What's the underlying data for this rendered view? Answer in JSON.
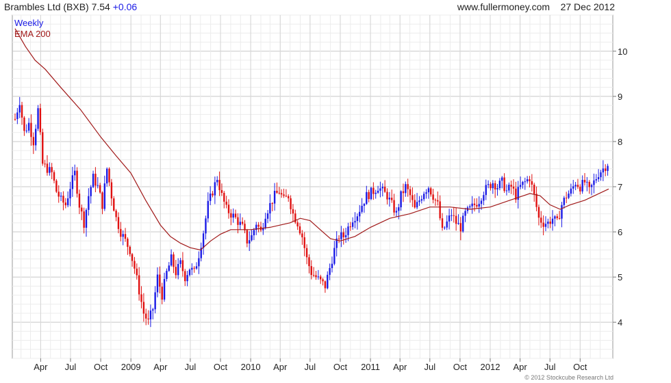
{
  "header": {
    "symbol_text": "Brambles Ltd (BXB) 7.54",
    "change": "+0.06",
    "source": "www.fullermoney.com",
    "date": "27 Dec 2012"
  },
  "copyright": "© 2012 Stockcube Research Ltd",
  "colors": {
    "up": "#1a1ae6",
    "down": "#e01010",
    "ema": "#a01818",
    "grid": "#cfcfcf"
  },
  "chart_data": {
    "type": "candlestick",
    "frequency": "Weekly",
    "legend": [
      {
        "name": "Weekly",
        "color": "#1a1ae6"
      },
      {
        "name": "EMA 200",
        "color": "#a01818"
      }
    ],
    "ylim": [
      3.2,
      10.8
    ],
    "y_ticks": [
      4,
      5,
      6,
      7,
      8,
      9,
      10
    ],
    "x_range": [
      "2008-01-14",
      "2012-12-27"
    ],
    "x_ticks": [
      {
        "label": "Apr",
        "date": "2008-04-01"
      },
      {
        "label": "Jul",
        "date": "2008-07-01"
      },
      {
        "label": "Oct",
        "date": "2008-10-01"
      },
      {
        "label": "2009",
        "date": "2009-01-01"
      },
      {
        "label": "Apr",
        "date": "2009-04-01"
      },
      {
        "label": "Jul",
        "date": "2009-07-01"
      },
      {
        "label": "Oct",
        "date": "2009-10-01"
      },
      {
        "label": "2010",
        "date": "2010-01-01"
      },
      {
        "label": "Apr",
        "date": "2010-04-01"
      },
      {
        "label": "Jul",
        "date": "2010-07-01"
      },
      {
        "label": "Oct",
        "date": "2010-10-01"
      },
      {
        "label": "2011",
        "date": "2011-01-01"
      },
      {
        "label": "Apr",
        "date": "2011-04-01"
      },
      {
        "label": "Jul",
        "date": "2011-07-01"
      },
      {
        "label": "Oct",
        "date": "2011-10-01"
      },
      {
        "label": "2012",
        "date": "2012-01-01"
      },
      {
        "label": "Apr",
        "date": "2012-04-01"
      },
      {
        "label": "Jul",
        "date": "2012-07-01"
      },
      {
        "label": "Oct",
        "date": "2012-10-01"
      }
    ],
    "close_path": [
      [
        "2008-01-14",
        8.5
      ],
      [
        "2008-01-28",
        8.9
      ],
      [
        "2008-02-11",
        8.2
      ],
      [
        "2008-02-25",
        8.4
      ],
      [
        "2008-03-10",
        8.0
      ],
      [
        "2008-03-24",
        8.7
      ],
      [
        "2008-04-07",
        7.5
      ],
      [
        "2008-04-21",
        7.4
      ],
      [
        "2008-05-05",
        7.3
      ],
      [
        "2008-05-19",
        6.9
      ],
      [
        "2008-06-02",
        6.7
      ],
      [
        "2008-06-16",
        6.6
      ],
      [
        "2008-06-30",
        7.0
      ],
      [
        "2008-07-14",
        7.3
      ],
      [
        "2008-07-28",
        6.6
      ],
      [
        "2008-08-11",
        6.2
      ],
      [
        "2008-08-25",
        6.8
      ],
      [
        "2008-09-08",
        7.2
      ],
      [
        "2008-09-22",
        7.0
      ],
      [
        "2008-10-06",
        6.6
      ],
      [
        "2008-10-20",
        7.4
      ],
      [
        "2008-11-03",
        6.8
      ],
      [
        "2008-11-17",
        6.3
      ],
      [
        "2008-12-01",
        6.0
      ],
      [
        "2008-12-15",
        5.8
      ],
      [
        "2008-12-29",
        5.6
      ],
      [
        "2009-01-12",
        5.2
      ],
      [
        "2009-01-26",
        4.7
      ],
      [
        "2009-02-09",
        4.2
      ],
      [
        "2009-02-23",
        4.0
      ],
      [
        "2009-03-09",
        4.3
      ],
      [
        "2009-03-23",
        5.0
      ],
      [
        "2009-04-06",
        4.6
      ],
      [
        "2009-04-20",
        5.1
      ],
      [
        "2009-05-04",
        5.4
      ],
      [
        "2009-05-18",
        5.1
      ],
      [
        "2009-06-01",
        5.3
      ],
      [
        "2009-06-15",
        5.0
      ],
      [
        "2009-06-29",
        5.2
      ],
      [
        "2009-07-13",
        5.1
      ],
      [
        "2009-07-27",
        5.5
      ],
      [
        "2009-08-10",
        6.0
      ],
      [
        "2009-08-24",
        6.6
      ],
      [
        "2009-09-07",
        6.9
      ],
      [
        "2009-09-21",
        7.2
      ],
      [
        "2009-10-05",
        6.8
      ],
      [
        "2009-10-19",
        6.5
      ],
      [
        "2009-11-02",
        6.4
      ],
      [
        "2009-11-16",
        6.3
      ],
      [
        "2009-12-07",
        6.1
      ],
      [
        "2009-12-21",
        5.8
      ],
      [
        "2010-01-04",
        5.9
      ],
      [
        "2010-01-18",
        6.2
      ],
      [
        "2010-02-01",
        6.0
      ],
      [
        "2010-02-15",
        6.4
      ],
      [
        "2010-03-01",
        6.6
      ],
      [
        "2010-03-15",
        6.8
      ],
      [
        "2010-03-29",
        6.9
      ],
      [
        "2010-04-12",
        6.7
      ],
      [
        "2010-04-26",
        6.8
      ],
      [
        "2010-05-10",
        6.4
      ],
      [
        "2010-05-24",
        6.2
      ],
      [
        "2010-06-07",
        5.9
      ],
      [
        "2010-06-21",
        5.4
      ],
      [
        "2010-07-05",
        5.1
      ],
      [
        "2010-07-19",
        5.0
      ],
      [
        "2010-08-02",
        4.9
      ],
      [
        "2010-08-16",
        4.8
      ],
      [
        "2010-08-30",
        5.2
      ],
      [
        "2010-09-13",
        5.6
      ],
      [
        "2010-09-27",
        5.9
      ],
      [
        "2010-10-11",
        5.9
      ],
      [
        "2010-10-25",
        6.1
      ],
      [
        "2010-11-08",
        6.3
      ],
      [
        "2010-11-22",
        6.4
      ],
      [
        "2010-12-06",
        6.6
      ],
      [
        "2010-12-20",
        6.8
      ],
      [
        "2011-01-10",
        6.9
      ],
      [
        "2011-01-24",
        7.0
      ],
      [
        "2011-02-07",
        6.9
      ],
      [
        "2011-02-21",
        6.8
      ],
      [
        "2011-03-07",
        6.6
      ],
      [
        "2011-03-21",
        6.4
      ],
      [
        "2011-04-04",
        6.8
      ],
      [
        "2011-04-18",
        7.0
      ],
      [
        "2011-05-02",
        6.8
      ],
      [
        "2011-05-16",
        6.5
      ],
      [
        "2011-05-30",
        6.7
      ],
      [
        "2011-06-13",
        6.9
      ],
      [
        "2011-06-27",
        7.0
      ],
      [
        "2011-07-11",
        6.8
      ],
      [
        "2011-07-25",
        6.6
      ],
      [
        "2011-08-08",
        6.0
      ],
      [
        "2011-08-22",
        6.2
      ],
      [
        "2011-09-05",
        6.4
      ],
      [
        "2011-09-19",
        6.2
      ],
      [
        "2011-10-03",
        6.1
      ],
      [
        "2011-10-17",
        6.4
      ],
      [
        "2011-10-31",
        6.5
      ],
      [
        "2011-11-14",
        6.6
      ],
      [
        "2011-11-28",
        6.7
      ],
      [
        "2011-12-12",
        6.9
      ],
      [
        "2011-12-26",
        7.0
      ],
      [
        "2012-01-09",
        7.1
      ],
      [
        "2012-01-23",
        7.0
      ],
      [
        "2012-02-06",
        7.1
      ],
      [
        "2012-02-20",
        6.9
      ],
      [
        "2012-03-05",
        7.0
      ],
      [
        "2012-03-19",
        6.8
      ],
      [
        "2012-04-02",
        7.0
      ],
      [
        "2012-04-16",
        7.1
      ],
      [
        "2012-04-30",
        7.2
      ],
      [
        "2012-05-14",
        6.8
      ],
      [
        "2012-05-28",
        6.3
      ],
      [
        "2012-06-11",
        6.2
      ],
      [
        "2012-06-25",
        6.2
      ],
      [
        "2012-07-09",
        6.3
      ],
      [
        "2012-07-23",
        6.2
      ],
      [
        "2012-08-06",
        6.6
      ],
      [
        "2012-08-20",
        6.8
      ],
      [
        "2012-09-03",
        6.9
      ],
      [
        "2012-09-17",
        7.1
      ],
      [
        "2012-10-01",
        7.0
      ],
      [
        "2012-10-15",
        7.1
      ],
      [
        "2012-10-29",
        6.9
      ],
      [
        "2012-11-12",
        7.1
      ],
      [
        "2012-11-26",
        7.3
      ],
      [
        "2012-12-10",
        7.4
      ],
      [
        "2012-12-27",
        7.54
      ]
    ],
    "ema_200": [
      [
        "2008-01-14",
        10.5
      ],
      [
        "2008-02-15",
        10.1
      ],
      [
        "2008-03-15",
        9.8
      ],
      [
        "2008-04-15",
        9.6
      ],
      [
        "2008-06-01",
        9.2
      ],
      [
        "2008-08-01",
        8.7
      ],
      [
        "2008-10-01",
        8.1
      ],
      [
        "2008-11-15",
        7.7
      ],
      [
        "2009-01-01",
        7.3
      ],
      [
        "2009-02-15",
        6.7
      ],
      [
        "2009-04-01",
        6.15
      ],
      [
        "2009-05-01",
        5.9
      ],
      [
        "2009-06-01",
        5.75
      ],
      [
        "2009-07-01",
        5.65
      ],
      [
        "2009-08-01",
        5.6
      ],
      [
        "2009-09-01",
        5.8
      ],
      [
        "2009-10-01",
        5.95
      ],
      [
        "2009-11-01",
        6.05
      ],
      [
        "2009-12-01",
        6.05
      ],
      [
        "2010-01-01",
        6.05
      ],
      [
        "2010-03-01",
        6.1
      ],
      [
        "2010-05-01",
        6.2
      ],
      [
        "2010-06-01",
        6.3
      ],
      [
        "2010-07-01",
        6.25
      ],
      [
        "2010-08-01",
        6.05
      ],
      [
        "2010-09-01",
        5.85
      ],
      [
        "2010-10-01",
        5.8
      ],
      [
        "2010-11-15",
        5.9
      ],
      [
        "2011-01-01",
        6.1
      ],
      [
        "2011-03-01",
        6.3
      ],
      [
        "2011-05-01",
        6.4
      ],
      [
        "2011-07-01",
        6.55
      ],
      [
        "2011-09-01",
        6.55
      ],
      [
        "2011-11-01",
        6.5
      ],
      [
        "2012-01-01",
        6.55
      ],
      [
        "2012-03-01",
        6.7
      ],
      [
        "2012-05-01",
        6.85
      ],
      [
        "2012-06-01",
        6.8
      ],
      [
        "2012-07-01",
        6.6
      ],
      [
        "2012-08-01",
        6.5
      ],
      [
        "2012-09-01",
        6.6
      ],
      [
        "2012-10-15",
        6.7
      ],
      [
        "2012-12-27",
        6.95
      ]
    ]
  }
}
